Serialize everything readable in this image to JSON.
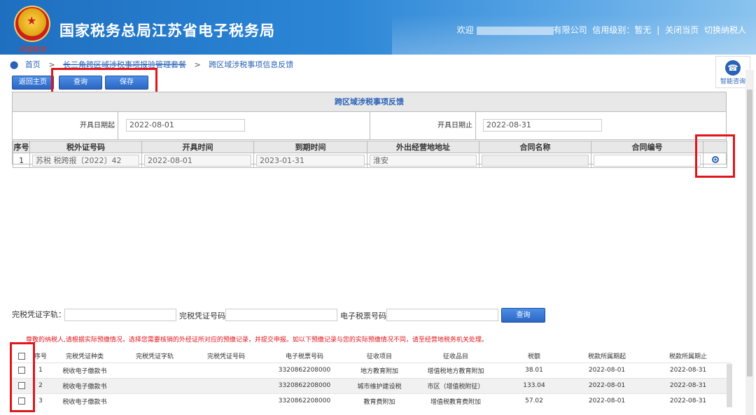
{
  "header": {
    "title": "国家税务总局江苏省电子税务局",
    "emblem_sub": "中国税务",
    "welcome": "欢迎",
    "company_suffix": "有限公司",
    "credit": "信用级别：暂无",
    "close": "关闭当页",
    "switch": "切换纳税人",
    "sep": "|"
  },
  "assist": {
    "label": "智能咨询",
    "icon": "headset-icon"
  },
  "breadcrumb": {
    "home": "首页",
    "level2": "长三角跨区域涉税事项报验管理套餐",
    "level3": "跨区域涉税事项信息反馈",
    "sep": ">"
  },
  "toolbar": {
    "back": "返回主页",
    "query": "查询",
    "save": "保存"
  },
  "panel": {
    "title": "跨区域涉税事项反馈",
    "date_from_label": "开具日期起",
    "date_from": "2022-08-01",
    "date_to_label": "开具日期止",
    "date_to": "2022-08-31"
  },
  "table1": {
    "headers": [
      "序号",
      "税外证号码",
      "开具时间",
      "到期时间",
      "外出经营地地址",
      "合同名称",
      "合同编号",
      ""
    ],
    "rows": [
      {
        "no": "1",
        "cert": "苏税 税跨报〔2022〕42",
        "open": "2022-08-01",
        "expire": "2023-01-31",
        "addr": "淮安",
        "contract_name": "",
        "contract_no": ""
      }
    ]
  },
  "search": {
    "label1": "完税凭证字轨：",
    "label2": "完税凭证号码:",
    "label3": "电子税票号码:",
    "button": "查询"
  },
  "notice": "尊敬的纳税人,请根据实际预缴情况，选择您需要核销的外经证所对应的预缴记录，并提交申报。如以下预缴记录与您的实际预缴情况不同，请至经营地税务机关处理。",
  "table2": {
    "headers": [
      "",
      "序号",
      "完税凭证种类",
      "完税凭证字轨",
      "完税凭证号码",
      "电子税票号码",
      "征收项目",
      "征收品目",
      "税额",
      "税款所属期起",
      "税款所属期止"
    ],
    "rows": [
      {
        "no": "1",
        "kind": "税收电子缴款书",
        "track": "",
        "num": "",
        "eno": "3320862208000",
        "item": "地方教育附加",
        "sub": "增值税地方教育附加",
        "tax": "38.01",
        "from": "2022-08-01",
        "to": "2022-08-31"
      },
      {
        "no": "2",
        "kind": "税收电子缴款书",
        "track": "",
        "num": "",
        "eno": "3320862208000",
        "item": "城市维护建设税",
        "sub": "市区（增值税附征）",
        "tax": "133.04",
        "from": "2022-08-01",
        "to": "2022-08-31"
      },
      {
        "no": "3",
        "kind": "税收电子缴款书",
        "track": "",
        "num": "",
        "eno": "3320862208000",
        "item": "教育费附加",
        "sub": "增值税教育费附加",
        "tax": "57.02",
        "from": "2022-08-01",
        "to": "2022-08-31"
      }
    ]
  },
  "colors": {
    "accent": "#2a62b8",
    "highlight": "#e0161b"
  }
}
